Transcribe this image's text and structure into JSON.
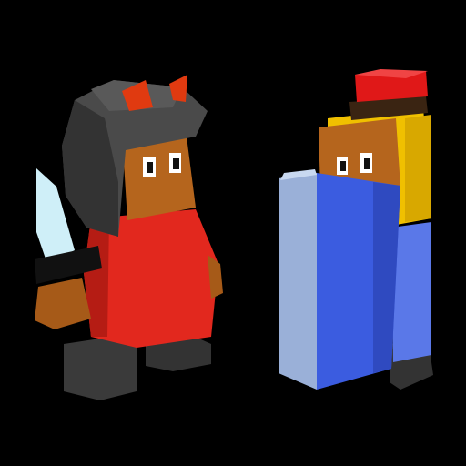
{
  "scene": {
    "description_kind": "game-render",
    "background": "#000000",
    "characters": [
      {
        "role": "warrior",
        "icon": "horned-helmet-warrior-icon",
        "colors": {
          "helmet": "#4a4a4a",
          "horns": "#e03a10",
          "skin": "#b5651d",
          "body": "#e2281e",
          "boots": "#3a3a3a",
          "sword": "#cfeff8"
        }
      },
      {
        "role": "knight-with-shield",
        "icon": "shield-knight-icon",
        "colors": {
          "hat": "#e01818",
          "hat_band": "#3a2412",
          "hair": "#f0c000",
          "skin": "#b5651d",
          "shield_front": "#3b5ce0",
          "shield_side": "#9ab0d8",
          "tunic": "#5a78e8",
          "boots": "#3a3a3a"
        }
      }
    ]
  }
}
